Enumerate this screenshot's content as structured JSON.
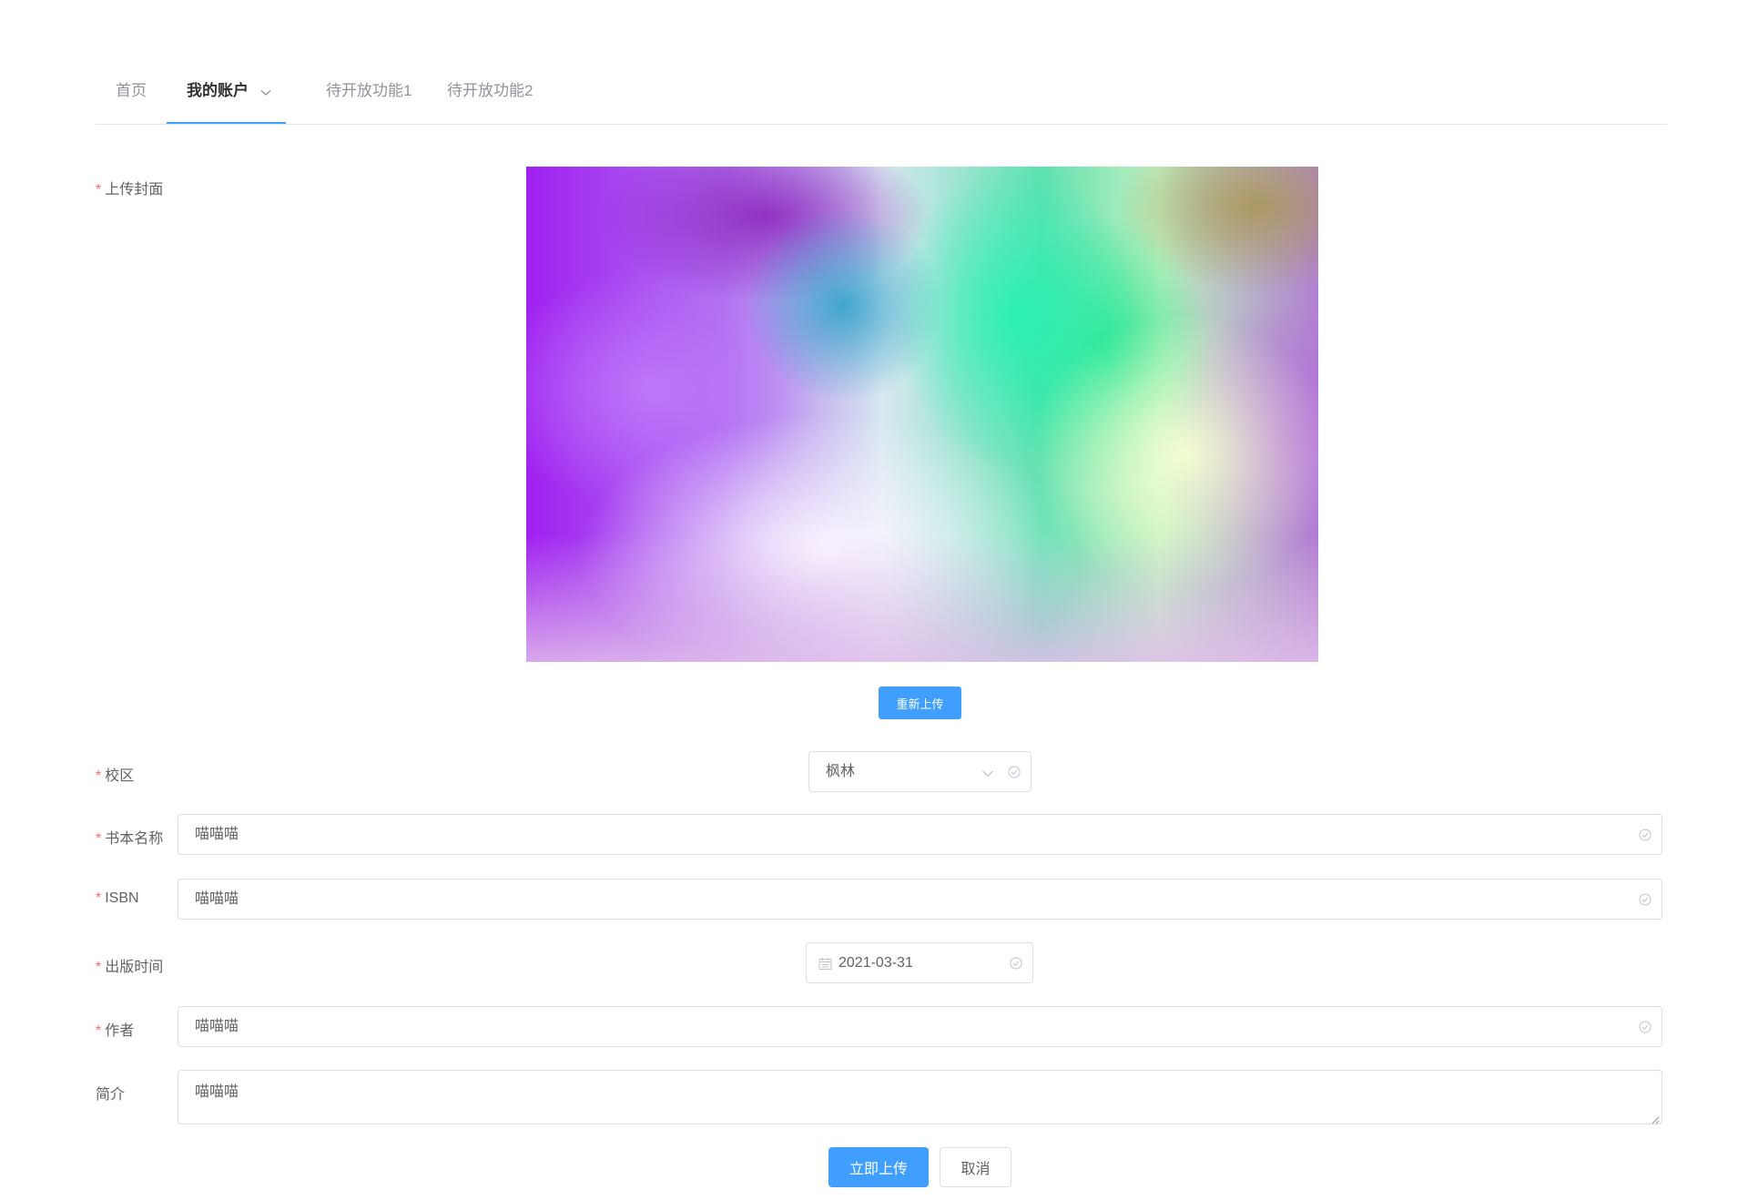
{
  "nav": {
    "items": [
      {
        "label": "首页"
      },
      {
        "label": "我的账户"
      },
      {
        "label": "待开放功能1"
      },
      {
        "label": "待开放功能2"
      }
    ]
  },
  "form": {
    "cover": {
      "label": "上传封面",
      "reupload_button": "重新上传"
    },
    "campus": {
      "label": "校区",
      "value": "枫林"
    },
    "book_name": {
      "label": "书本名称",
      "value": "喵喵喵"
    },
    "isbn": {
      "label": "ISBN",
      "value": "喵喵喵"
    },
    "publish_date": {
      "label": "出版时间",
      "value": "2021-03-31"
    },
    "author": {
      "label": "作者",
      "value": "喵喵喵"
    },
    "intro": {
      "label": "简介",
      "value": "喵喵喵"
    }
  },
  "actions": {
    "submit": "立即上传",
    "cancel": "取消"
  },
  "colors": {
    "primary": "#409eff",
    "required": "#f56c6c",
    "border": "#dcdfe6"
  }
}
